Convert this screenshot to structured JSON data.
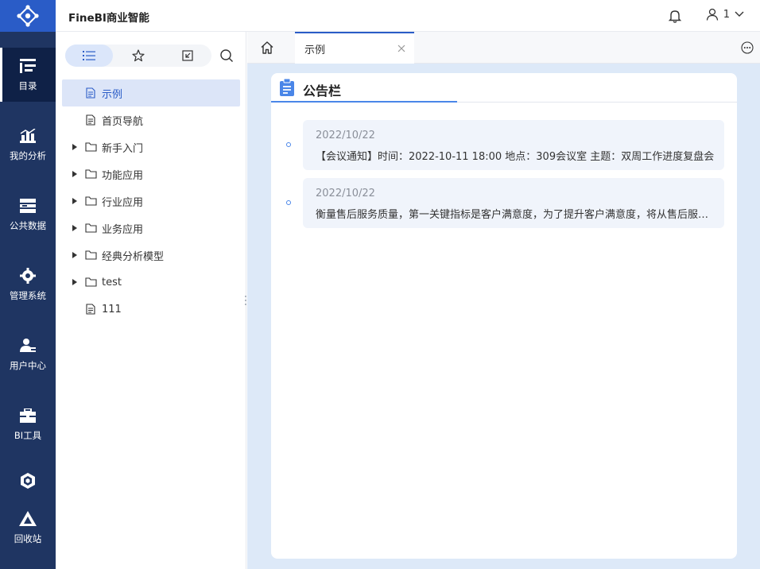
{
  "header": {
    "app_title": "FineBI商业智能",
    "user_name": "1"
  },
  "rail": {
    "items": [
      {
        "label": "目录",
        "icon": "catalog-icon",
        "active": true
      },
      {
        "label": "我的分析",
        "icon": "analysis-icon"
      },
      {
        "label": "公共数据",
        "icon": "database-icon"
      },
      {
        "label": "管理系统",
        "icon": "gear-icon"
      },
      {
        "label": "用户中心",
        "icon": "user-card-icon"
      },
      {
        "label": "BI工具",
        "icon": "toolbox-icon"
      },
      {
        "label": "",
        "icon": "cube-icon"
      },
      {
        "label": "回收站",
        "icon": "recycle-icon"
      }
    ]
  },
  "directory": {
    "toolbar": [
      "list-icon",
      "star-icon",
      "export-icon",
      "search-icon"
    ],
    "tree": [
      {
        "label": "示例",
        "type": "file",
        "selected": true
      },
      {
        "label": "首页导航",
        "type": "file"
      },
      {
        "label": "新手入门",
        "type": "folder"
      },
      {
        "label": "功能应用",
        "type": "folder"
      },
      {
        "label": "行业应用",
        "type": "folder"
      },
      {
        "label": "业务应用",
        "type": "folder"
      },
      {
        "label": "经典分析模型",
        "type": "folder"
      },
      {
        "label": "test",
        "type": "folder"
      },
      {
        "label": "111",
        "type": "file"
      }
    ]
  },
  "tabs": {
    "active_label": "示例"
  },
  "board": {
    "title": "公告栏",
    "notices": [
      {
        "date": "2022/10/22",
        "text": "【会议通知】时间：2022-10-11 18:00 地点：309会议室 主题：双周工作进度复盘会"
      },
      {
        "date": "2022/10/22",
        "text": "衡量售后服务质量，第一关键指标是客户满意度，为了提升客户满意度，将从售后服务流程优化入手"
      }
    ]
  },
  "colors": {
    "rail_bg": "#1f3562",
    "accent": "#2a5cc7",
    "main_bg": "#dde9f8"
  }
}
